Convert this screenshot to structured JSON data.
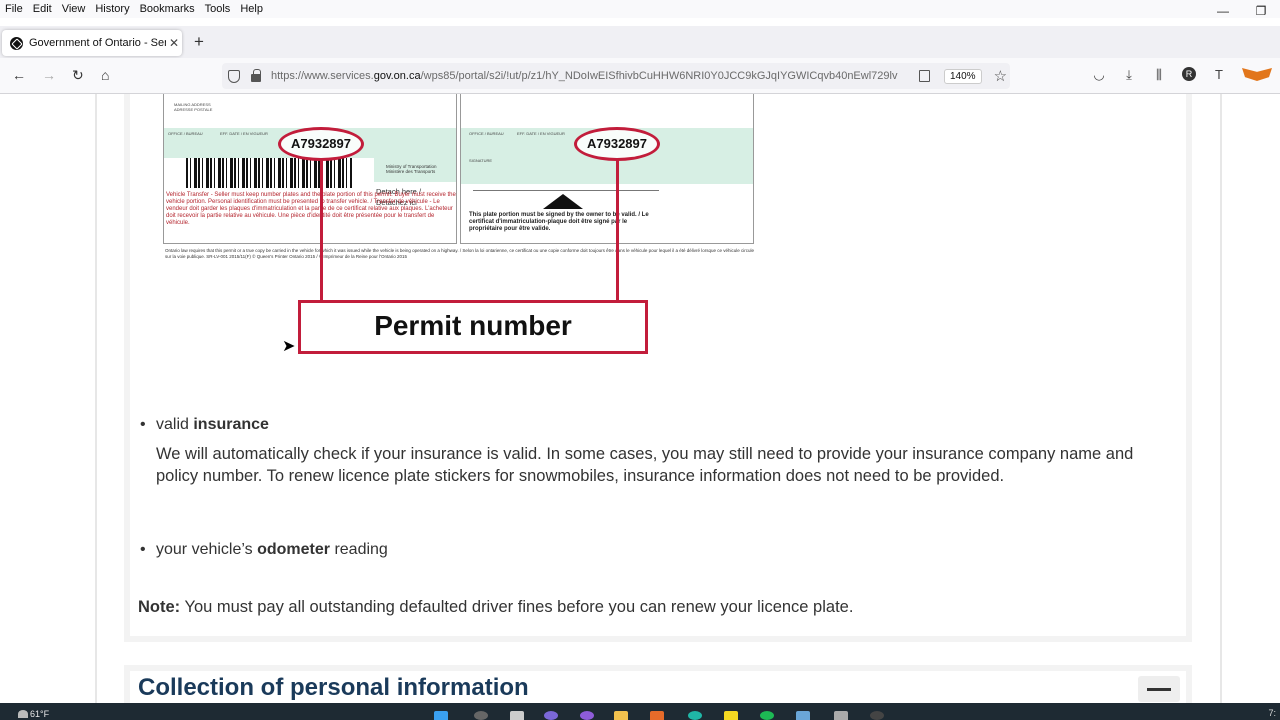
{
  "menu": [
    "File",
    "Edit",
    "View",
    "History",
    "Bookmarks",
    "Tools",
    "Help"
  ],
  "window_controls": {
    "minimize": "—",
    "restore": "❐"
  },
  "tab": {
    "title": "Government of Ontario - Servic",
    "close": "✕"
  },
  "new_tab": "+",
  "nav": {
    "back": "←",
    "forward": "→",
    "reload": "↻",
    "home": "⌂"
  },
  "url": {
    "host_prefix": "https://www.services.",
    "host": "gov.on.ca",
    "path": "/wps85/portal/s2i/!ut/p/z1/hY_NDoIwEISfhivbCuHHW6NRI0Y0JCC9kGJqIYGWICqvb40nEwl729lv"
  },
  "zoom": "140%",
  "toolbar_icons": [
    "pocket-icon",
    "download-icon",
    "library-icon",
    "account-icon",
    "translate-icon",
    "metamask-icon"
  ],
  "avatar_letter": "R",
  "figure": {
    "permit_number": "A7932897",
    "label": "Permit number",
    "detach": "Detach here /\nDétachez ici",
    "red_text": "Vehicle Transfer - Seller must keep number plates and the plate portion of this permit. Buyer must receive the vehicle portion. Personal identification must be presented to transfer vehicle. / Transfer de véhicule - Le vendeur doit garder les plaques d'immatriculation et la partie de ce certificat relative aux plaques. L'acheteur doit recevoir la partie relative au véhicule. Une pièce d'identité doit être présentée pour le transfert de véhicule.",
    "plate_text": "This plate portion must be signed by the owner to be valid. / Le certificat d'immatriculation-plaque doit être signé par le propriétaire pour être valide.",
    "ministry": "Ministry of Transportation\nMinistère des Transports",
    "footnote": "Ontario law requires that this permit or a true copy be carried in the vehicle for which it was issued while the vehicle is being operated on a highway. / Selon la loi ontarienne, ce certificat ou une copie conforme doit toujours être dans le véhicule pour lequel il a été délivré lorsque ce véhicule circule sur la voie publique. SR-LV-001 2015/11(F) © Queen's Printer Ontario 2015 / © Imprimeur de la Reine pour l'Ontario 2015",
    "mailing": "MAILING ADDRESS\nADRESSE POSTALE",
    "office": "OFFICE / BUREAU",
    "eff_date": "EFF. DATE / EN VIGUEUR",
    "signature": "SIGNATURE"
  },
  "content": {
    "b1_prefix": "valid ",
    "b1_bold": "insurance",
    "b1_para": "We will automatically check if your insurance is valid. In some cases, you may still need to provide your insurance company name and policy number. To renew licence plate stickers for snowmobiles, insurance information does not need to be provided.",
    "b2_prefix": "your vehicle’s ",
    "b2_bold": "odometer",
    "b2_suffix": " reading",
    "note_label": "Note:",
    "note_text": " You must pay all outstanding defaulted driver fines before you can renew your licence plate.",
    "section_heading": "Collection of personal information"
  },
  "taskbar": {
    "weather": "61°F",
    "clock": "7:"
  }
}
